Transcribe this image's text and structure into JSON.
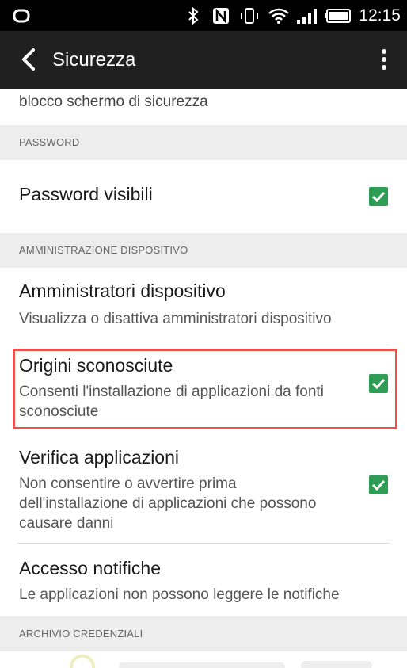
{
  "status_bar": {
    "time": "12:15",
    "icons": [
      "htc-logo-icon",
      "bluetooth-icon",
      "nfc-icon",
      "vibrate-icon",
      "wifi-icon",
      "signal-icon",
      "battery-icon"
    ]
  },
  "action_bar": {
    "title": "Sicurezza",
    "back_icon": "back-arrow-icon",
    "overflow_icon": "overflow-menu-icon"
  },
  "screen": {
    "partial_top_text": "blocco schermo di sicurezza",
    "sections": [
      {
        "header": "PASSWORD",
        "items": [
          {
            "title": "Password visibili",
            "subtitle": "",
            "checked": true
          }
        ]
      },
      {
        "header": "AMMINISTRAZIONE DISPOSITIVO",
        "items": [
          {
            "title": "Amministratori dispositivo",
            "subtitle": "Visualizza o disattiva amministratori dispositivo",
            "checked": null
          },
          {
            "title": "Origini sconosciute",
            "subtitle": "Consenti l'installazione di applicazioni da fonti sconosciute",
            "checked": true,
            "highlighted": true
          },
          {
            "title": "Verifica applicazioni",
            "subtitle": "Non consentire o avvertire prima dell'installazione di applicazioni che possono causare danni",
            "checked": true
          },
          {
            "title": "Accesso notifiche",
            "subtitle": "Le applicazioni non possono leggere le notifiche",
            "checked": null
          }
        ]
      },
      {
        "header": "ARCHIVIO CREDENZIALI",
        "items": []
      }
    ]
  },
  "colors": {
    "status_bar": "#000000",
    "action_bar": "#202020",
    "section_header_bg": "#ededed",
    "checkbox": "#2e9e55",
    "highlight_border": "#e8524a"
  }
}
